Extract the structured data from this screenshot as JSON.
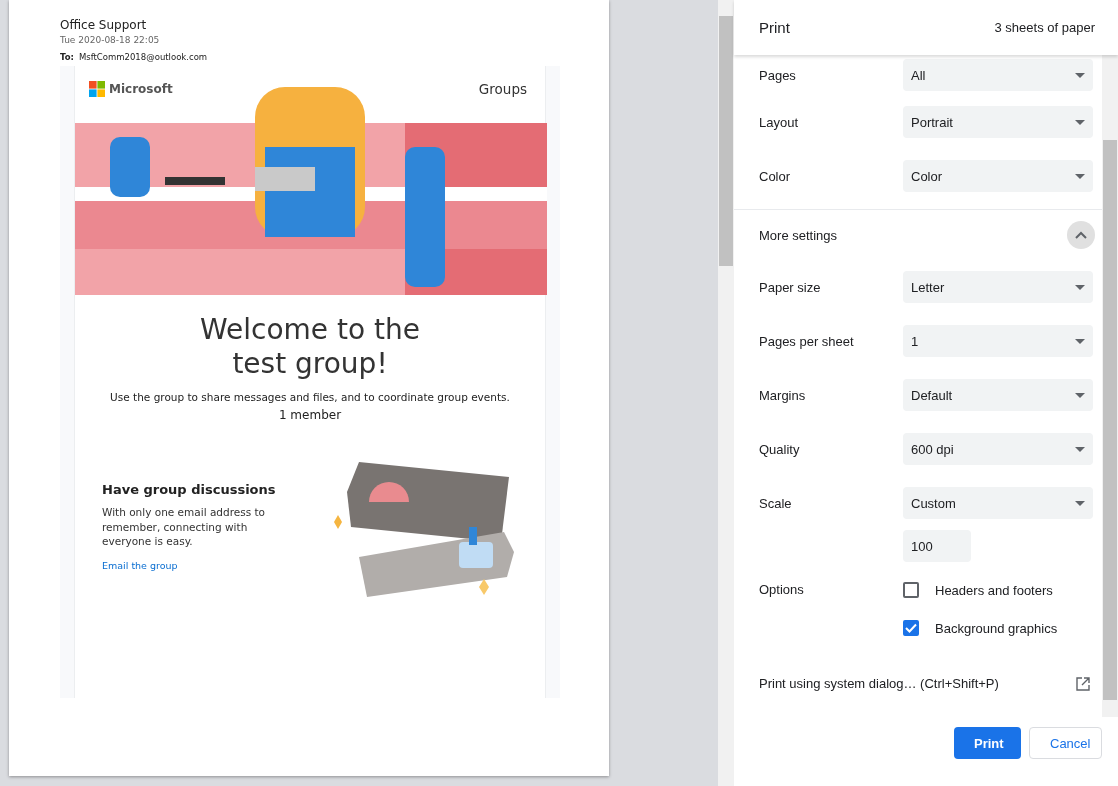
{
  "preview": {
    "sender": "Office Support",
    "date": "Tue 2020-08-18 22:05",
    "to_label": "To:",
    "to": "MsftComm2018@outlook.com",
    "brand": "Microsoft",
    "product": "Groups",
    "heading": "Welcome to the test group!",
    "intro": "Use the group to share messages and files, and to coordinate group events.",
    "members": "1 member",
    "feature": {
      "title": "Have group discussions",
      "body": "With only one email address to remember, connecting with everyone is easy.",
      "link": "Email the group"
    }
  },
  "print": {
    "title": "Print",
    "sheets": "3 sheets of paper",
    "settings": [
      {
        "label": "Pages",
        "value": "All"
      },
      {
        "label": "Layout",
        "value": "Portrait"
      },
      {
        "label": "Color",
        "value": "Color"
      }
    ],
    "more_settings": {
      "label": "More settings",
      "expanded": true
    },
    "more": [
      {
        "label": "Paper size",
        "value": "Letter"
      },
      {
        "label": "Pages per sheet",
        "value": "1"
      },
      {
        "label": "Margins",
        "value": "Default"
      },
      {
        "label": "Quality",
        "value": "600 dpi"
      },
      {
        "label": "Scale",
        "value": "Custom"
      }
    ],
    "scale_value": "100",
    "options_label": "Options",
    "options": [
      {
        "label": "Headers and footers",
        "checked": false
      },
      {
        "label": "Background graphics",
        "checked": true
      }
    ],
    "system_dialog": "Print using system dialog… (Ctrl+Shift+P)",
    "buttons": [
      {
        "label": "Print",
        "kind": "primary"
      },
      {
        "label": "Cancel",
        "kind": "secondary"
      }
    ]
  }
}
